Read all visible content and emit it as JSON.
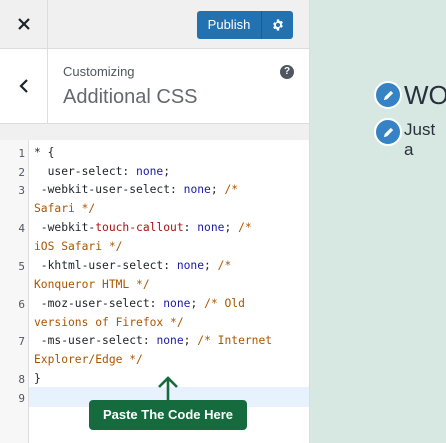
{
  "topbar": {
    "publish_label": "Publish"
  },
  "section": {
    "customizing_label": "Customizing",
    "title": "Additional CSS",
    "help": "?"
  },
  "editor": {
    "line_numbers": [
      "1",
      "2",
      "3",
      "4",
      "5",
      "6",
      "7",
      "8",
      "9"
    ]
  },
  "annotation": {
    "text": "Paste The Code Here"
  },
  "preview": {
    "heading": "WO",
    "text": "Just a"
  }
}
